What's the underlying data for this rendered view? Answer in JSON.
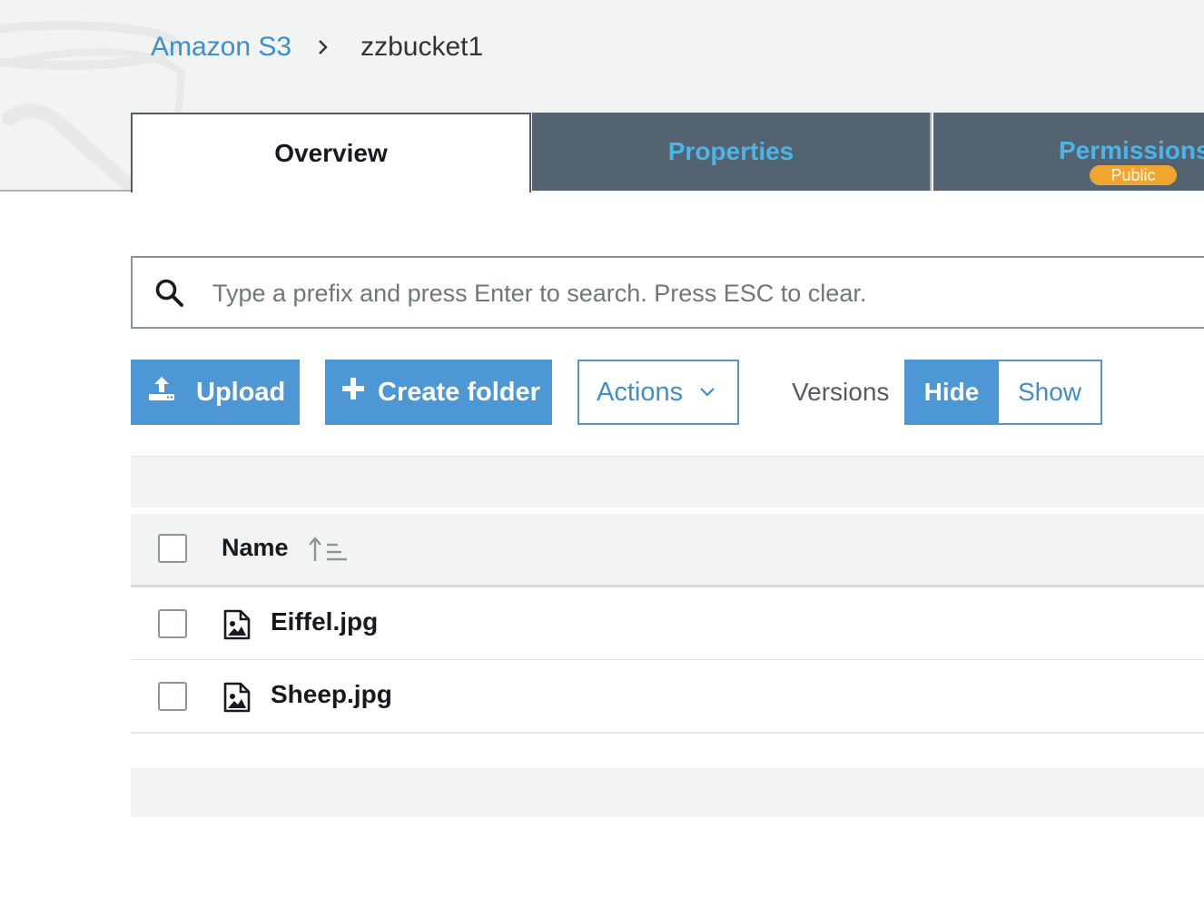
{
  "breadcrumb": {
    "root": "Amazon S3",
    "current": "zzbucket1"
  },
  "tabs": [
    {
      "label": "Overview",
      "active": true
    },
    {
      "label": "Properties",
      "active": false
    },
    {
      "label": "Permissions",
      "active": false,
      "badge": "Public"
    }
  ],
  "search": {
    "placeholder": "Type a prefix and press Enter to search. Press ESC to clear.",
    "value": ""
  },
  "toolbar": {
    "upload_label": "Upload",
    "upload_icon": "upload-icon",
    "create_folder_label": "Create folder",
    "create_folder_icon": "plus-icon",
    "actions_label": "Actions",
    "actions_icon": "chevron-down-icon",
    "versions_label": "Versions",
    "versions_hide": "Hide",
    "versions_show": "Show",
    "versions_selected": "Hide"
  },
  "table": {
    "columns": [
      {
        "label": "Name",
        "sort": "ascending"
      }
    ],
    "rows": [
      {
        "name": "Eiffel.jpg",
        "icon": "image-file-icon"
      },
      {
        "name": "Sheep.jpg",
        "icon": "image-file-icon"
      }
    ]
  },
  "colors": {
    "primary": "#4d97d4",
    "link": "#3f8ecb",
    "tab_inactive_bg": "#536372",
    "tab_inactive_text": "#4cb4e7",
    "badge": "#f0a531",
    "header_bg": "#f2f3f3"
  }
}
